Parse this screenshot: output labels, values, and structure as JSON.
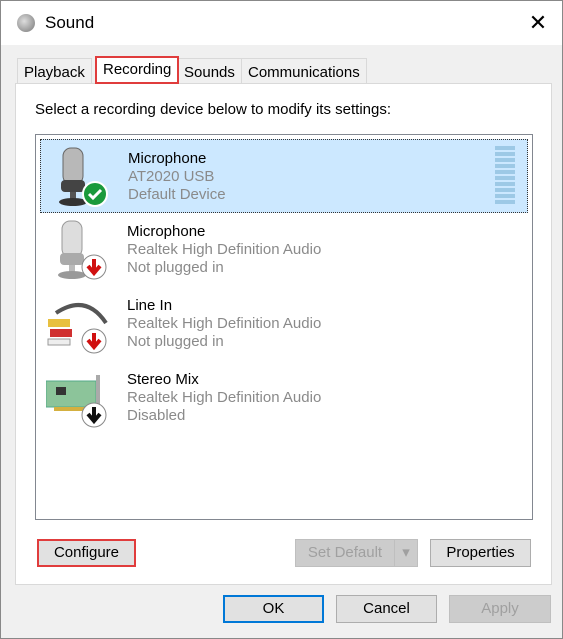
{
  "window": {
    "title": "Sound",
    "close_label": "✕"
  },
  "tabs": [
    {
      "label": "Playback"
    },
    {
      "label": "Recording",
      "active": true
    },
    {
      "label": "Sounds"
    },
    {
      "label": "Communications"
    }
  ],
  "instruction": "Select a recording device below to modify its settings:",
  "devices": [
    {
      "name": "Microphone",
      "driver": "AT2020 USB",
      "status": "Default Device",
      "icon": "microphone-icon",
      "badge": "green-check-icon",
      "selected": true
    },
    {
      "name": "Microphone",
      "driver": "Realtek High Definition Audio",
      "status": "Not plugged in",
      "icon": "microphone-icon",
      "badge": "red-down-arrow-icon"
    },
    {
      "name": "Line In",
      "driver": "Realtek High Definition Audio",
      "status": "Not plugged in",
      "icon": "rca-cable-icon",
      "badge": "red-down-arrow-icon"
    },
    {
      "name": "Stereo Mix",
      "driver": "Realtek High Definition Audio",
      "status": "Disabled",
      "icon": "sound-card-icon",
      "badge": "black-down-arrow-icon"
    }
  ],
  "buttons": {
    "configure": "Configure",
    "set_default": "Set Default",
    "properties": "Properties",
    "ok": "OK",
    "cancel": "Cancel",
    "apply": "Apply"
  },
  "colors": {
    "highlight": "#e03c3c",
    "selection": "#cce8ff",
    "default_button": "#0078d7"
  }
}
